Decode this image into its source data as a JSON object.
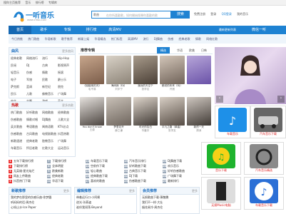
{
  "topbar": {
    "links": [
      "搜你主页推荐",
      "音乐",
      "排行榜",
      "专辑库"
    ]
  },
  "logo": {
    "text": "一听音乐",
    "sub": "WWW.1TING.COM"
  },
  "search": {
    "type": "歌曲",
    "placeholder": "在你所喜歡歌，如何開始搜尋你喜歡的歌",
    "button": "搜索"
  },
  "header_right": {
    "links": [
      "免费注册",
      "登录",
      "QQ登录",
      "我的音乐"
    ]
  },
  "nav": {
    "items": [
      "首页",
      "歌手",
      "专辑",
      "排行榜",
      "高清MV"
    ],
    "more": "最新更新列表",
    "login": "微信一听"
  },
  "hotbar": {
    "items": [
      "今日热推",
      "热门歌曲",
      "华语新歌",
      "歌手推荐",
      "新碟上架",
      "华语精选",
      "热门标签",
      "高清MV",
      "流行",
      "DJ舞曲",
      "伤感",
      "经典老歌",
      "情歌",
      "网络红歌"
    ]
  },
  "left_panel": {
    "title": "曲风",
    "more": "更多曲风",
    "rows": [
      [
        "经典老歌",
        "网络流行",
        "流行",
        "Hip-Hop"
      ],
      [
        "民谣",
        "DJ",
        "古典",
        "影视原声"
      ],
      [
        "轻音乐",
        "伤感",
        "情歌",
        "摇滚"
      ],
      [
        "电子",
        "军旅",
        "民歌",
        "爵士乐"
      ],
      [
        "萨克斯",
        "蓝调",
        "新世纪",
        "朋克"
      ],
      [
        "民乐",
        "儿歌",
        "佛教音乐",
        "广场舞"
      ],
      [
        "中文",
        "古筝",
        "游戏",
        "英文"
      ]
    ]
  },
  "left_panel2": {
    "title": "热歌",
    "more": "更多热歌",
    "rows": [
      [
        "热门歌曲",
        "好听歌曲",
        "网络歌曲",
        "经典歌曲"
      ],
      [
        "伤感歌曲",
        "情歌对唱",
        "DJ舞曲",
        "儿歌大全"
      ],
      [
        "英文歌曲",
        "粤语歌曲",
        "闽南语歌",
        "KTV必点"
      ],
      [
        "伤感歌曲",
        "古风歌曲",
        "电视剧歌曲",
        "抖音热歌"
      ],
      [
        "新歌速递",
        "经典老歌",
        "胎教音乐",
        "广场舞"
      ],
      [
        "车载音乐",
        "怀旧老歌",
        "红歌大全",
        "运动音乐"
      ]
    ]
  },
  "recommend": {
    "title": "推荐专辑",
    "tabs": [
      "精选",
      "华语",
      "欧美",
      "日韩"
    ],
    "row1": [
      {
        "name": "《姐姐她的天》",
        "artist": "毛不易"
      },
      {
        "name": "海阔我（DJ）",
        "artist": "刘宇宁"
      },
      {
        "name": "遥远的天空下",
        "artist": "张学友"
      },
      {
        "name": "都说的未来（DJ）",
        "artist": "许嵩"
      },
      {
        "name": "",
        "artist": ""
      }
    ],
    "row2": [
      {
        "name": "You don't know",
        "artist": "王源"
      },
      {
        "name": "梦里花开",
        "artist": "薛之谦"
      },
      {
        "name": "时光的告白",
        "artist": "华晨宇"
      },
      {
        "name": "平凡之路（单曲）",
        "artist": "张学友"
      },
      {
        "name": "新的一天",
        "artist": "周深"
      }
    ]
  },
  "ranking": {
    "col1": [
      {
        "n": "1",
        "t": "五年下载排行榜"
      },
      {
        "n": "2",
        "t": "下载排行榜"
      },
      {
        "n": "3",
        "t": "无英雄·星光灿烂"
      },
      {
        "n": "4",
        "t": "网友上传歌曲"
      },
      {
        "n": "5",
        "t": "抖音热门下载"
      }
    ],
    "col2": [
      {
        "n": "7",
        "t": "下载排行榜"
      },
      {
        "n": "8",
        "t": "全体明星"
      },
      {
        "n": "9",
        "t": "欧美新歌"
      },
      {
        "n": "10",
        "t": "经典老歌"
      },
      {
        "n": "11",
        "t": "华语下载"
      }
    ],
    "col3": [
      {
        "n": "13",
        "t": "车载音乐下载"
      },
      {
        "n": "14",
        "t": "空前作下载"
      },
      {
        "n": "15",
        "t": "轻心歌曲"
      },
      {
        "n": "16",
        "t": "经典歌曲下载"
      },
      {
        "n": "17",
        "t": "喜欢的歌曲"
      }
    ],
    "col4": [
      {
        "n": "19",
        "t": "汽车音乐排行"
      },
      {
        "n": "20",
        "t": "好听歌曲下载"
      },
      {
        "n": "21",
        "t": "古典音乐下载"
      },
      {
        "n": "22",
        "t": "DJ下载"
      },
      {
        "n": "23",
        "t": "伤感歌曲下载"
      }
    ],
    "col5": [
      {
        "n": "25",
        "t": "DJ舞曲下载"
      },
      {
        "n": "26",
        "t": "欢乐音乐"
      },
      {
        "n": "27",
        "t": "好听伤感歌曲"
      },
      {
        "n": "28",
        "t": "广场舞下载"
      },
      {
        "n": "29",
        "t": "最新排行"
      }
    ]
  },
  "bottom": {
    "b1": {
      "title": "新歌推荐",
      "more": "更多",
      "items": [
        "我的梦在那里的伤感乐曲·徐梦圆",
        "听妈妈的话·周杰伦",
        "心如止水·Ice Paper"
      ]
    },
    "b2": {
      "title": "编辑推荐",
      "more": "更多",
      "items": [
        "带着远行口·小阿枫",
        "逆光·孙燕姿",
        "谁伴我闯荡·Beyond"
      ]
    },
    "b3": {
      "title": "会员推荐",
      "more": "更多",
      "items": [
        "无损歌曲下载·萧敬腾",
        "我们不一样·大壮",
        "烟花易冷·周杰伦"
      ]
    }
  },
  "right_ads": {
    "banner": "",
    "apps1": [
      {
        "label": "车载音乐"
      },
      {
        "label": "汽车音乐下载"
      }
    ],
    "apps2": [
      {
        "label": "音乐下载"
      },
      {
        "label": "汽车音乐精选"
      }
    ],
    "apps3": [
      {
        "label": "无损Music电脑"
      },
      {
        "label": "车载音乐下载"
      }
    ]
  },
  "colors": {
    "accent": "#1e82d2",
    "rank": "#e33333"
  }
}
